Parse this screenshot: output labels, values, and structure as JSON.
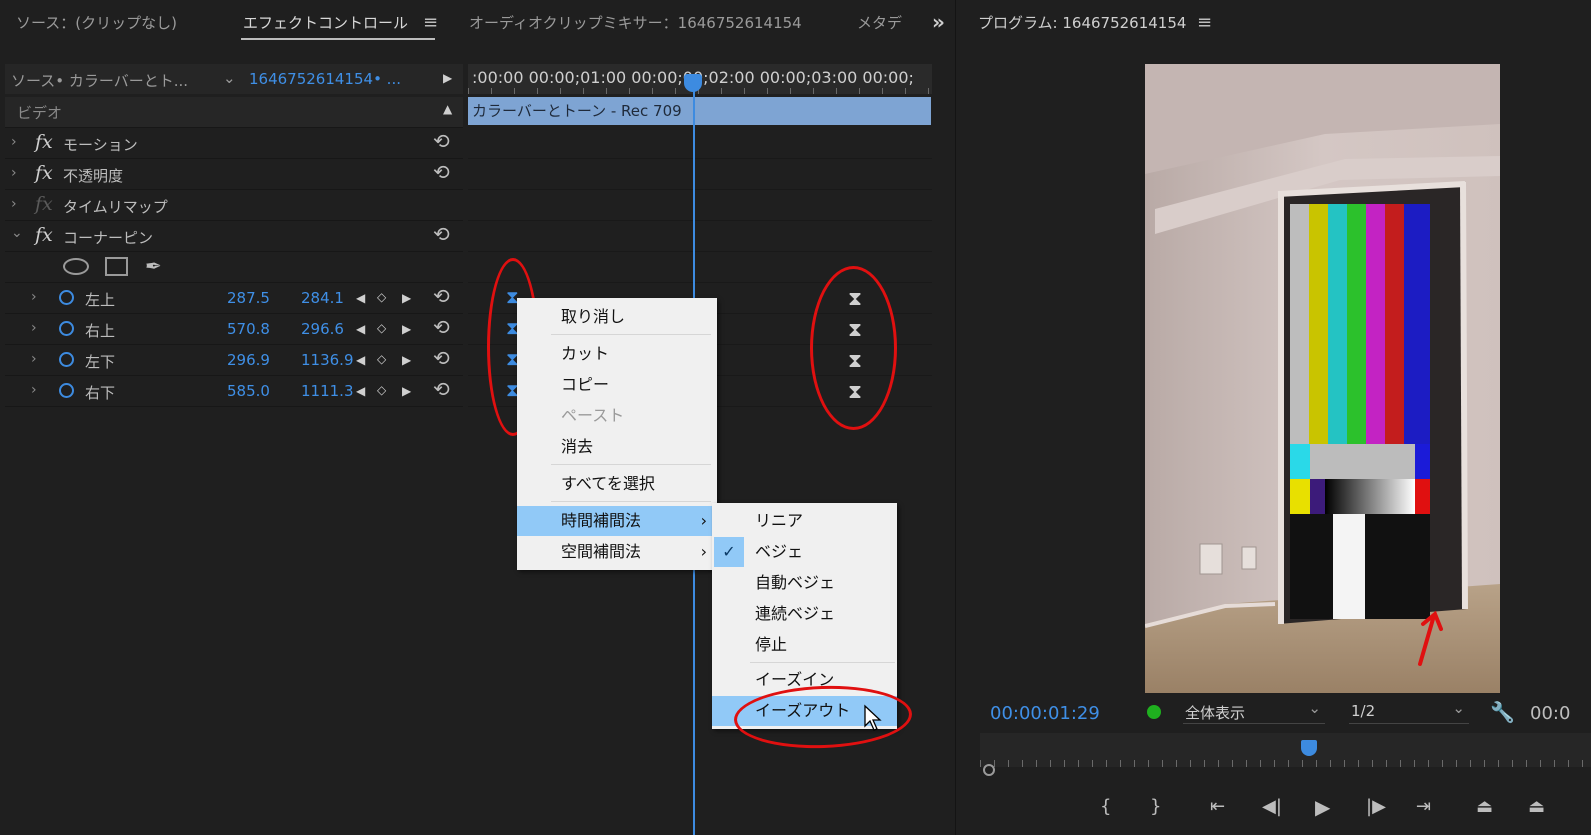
{
  "left_panel": {
    "tabs": [
      "ソース：(クリップなし)",
      "エフェクトコントロール",
      "オーディオクリップミキサー：1646752614154",
      "メタデ"
    ],
    "active_tab_index": 1,
    "overflow_glyph": "»",
    "source_label": "ソース• カラーバーとト...",
    "sequence_label": "1646752614154• ...",
    "timecodes": ":00:00 00:00;01:00 00:00;00;02:00 00:00;03:00 00:00;",
    "clip_name": "カラーバーとトーン - Rec 709",
    "section": "ビデオ",
    "effects": [
      {
        "name": "モーション",
        "enabled": true
      },
      {
        "name": "不透明度",
        "enabled": true
      },
      {
        "name": "タイムリマップ",
        "enabled": false
      },
      {
        "name": "コーナーピン",
        "enabled": true
      }
    ],
    "params": [
      {
        "name": "左上",
        "x": "287.5",
        "y": "284.1"
      },
      {
        "name": "右上",
        "x": "570.8",
        "y": "296.6"
      },
      {
        "name": "左下",
        "x": "296.9",
        "y": "1136.9"
      },
      {
        "name": "右下",
        "x": "585.0",
        "y": "1111.3"
      }
    ]
  },
  "context_menu": {
    "items": [
      "取り消し",
      "カット",
      "コピー",
      "ペースト",
      "消去",
      "すべてを選択",
      "時間補間法",
      "空間補間法"
    ],
    "disabled": [
      "ペースト"
    ],
    "highlighted": "時間補間法"
  },
  "submenu": {
    "items": [
      "リニア",
      "ベジェ",
      "自動ベジェ",
      "連続ベジェ",
      "停止",
      "イーズイン",
      "イーズアウト"
    ],
    "checked": "ベジェ",
    "highlighted": "イーズアウト"
  },
  "program_monitor": {
    "title": "プログラム: 1646752614154",
    "timecode": "00:00:01:29",
    "zoom": "全体表示",
    "resolution": "1/2",
    "end_timecode": "00:0"
  },
  "colors": {
    "accent": "#3d8be0",
    "annotation_red": "#e01010",
    "clip_bar": "#7ea4d3",
    "menu_highlight": "#91c9f7"
  }
}
